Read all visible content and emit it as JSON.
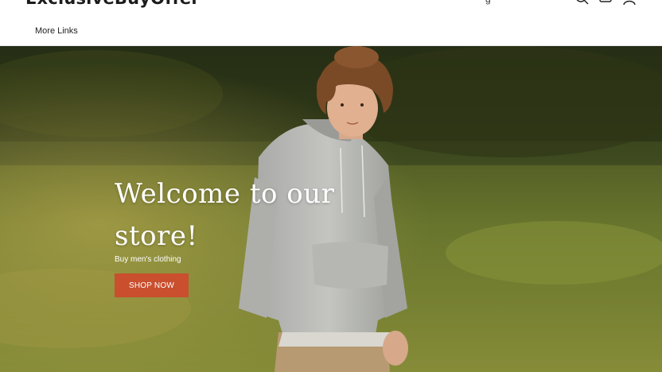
{
  "header": {
    "logo_text": "ExclusiveBuyOffer",
    "lang_stub": "g",
    "nav_more": "More Links",
    "icons": [
      "search-icon",
      "cart-icon",
      "account-icon"
    ]
  },
  "hero": {
    "title": "Welcome to our store!",
    "subtitle": "Buy men's clothing",
    "button_label": "SHOP NOW",
    "button_color": "#c94f2e"
  }
}
